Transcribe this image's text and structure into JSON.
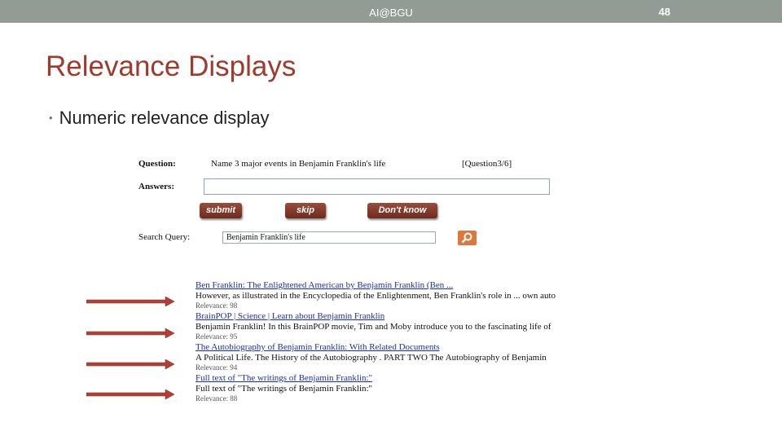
{
  "header": {
    "center_text": "AI@BGU",
    "page_number": "48"
  },
  "slide": {
    "title": "Relevance Displays",
    "bullet": "Numeric relevance display"
  },
  "screenshot": {
    "question_label": "Question:",
    "question_text": "Name 3 major events in Benjamin Franklin's life",
    "question_counter": "[Question3/6]",
    "answers_label": "Answers:",
    "answer_value": "",
    "buttons": {
      "submit": "submit",
      "skip": "skip",
      "dont_know": "Don't know"
    },
    "search_label": "Search Query:",
    "search_value": "Benjamin Franklin's life",
    "search_icon": "magnifier-icon",
    "results": [
      {
        "title": "Ben Franklin: The Enlightened American by Benjamin Franklin (Ben ...",
        "snippet": "However, as illustrated in the Encyclopedia of the Enlightenment, Ben Franklin's role in ... own auto",
        "relevance": "Relevance: 98"
      },
      {
        "title": "BrainPOP | Science | Learn about Benjamin Franklin",
        "snippet": "Benjamin Franklin! In this BrainPOP movie, Tim and Moby introduce you to the fascinating life of",
        "relevance": "Relevance: 95"
      },
      {
        "title": "The Autobiography of Benjamin Franklin: With Related Documents",
        "snippet": "A Political Life. The History of the Autobiography . PART TWO The Autobiography of Benjamin",
        "relevance": "Relevance: 94"
      },
      {
        "title": "Full text of \"The writings of Benjamin Franklin:\"",
        "snippet": "Full text of \"The writings of Benjamin Franklin:\"",
        "relevance": "Relevance: 88"
      }
    ]
  },
  "colors": {
    "topbar": "#929c95",
    "title": "#9c3b2e",
    "arrow": "#c0392b",
    "link": "#1a2eb0",
    "button": "#8a3b2d",
    "search_button": "#e0773a"
  }
}
